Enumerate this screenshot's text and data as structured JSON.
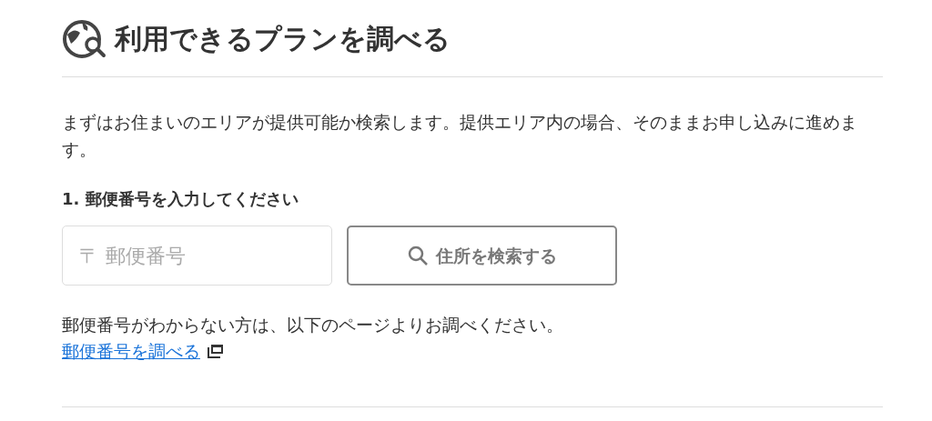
{
  "heading": "利用できるプランを調べる",
  "intro": "まずはお住まいのエリアが提供可能か検索します。提供エリア内の場合、そのままお申し込みに進めます。",
  "step": {
    "label": "1. 郵便番号を入力してください",
    "postal_field": {
      "placeholder": "〒 郵便番号"
    },
    "search_button": "住所を検索する"
  },
  "note": "郵便番号がわからない方は、以下のページよりお調べください。",
  "link": "郵便番号を調べる"
}
